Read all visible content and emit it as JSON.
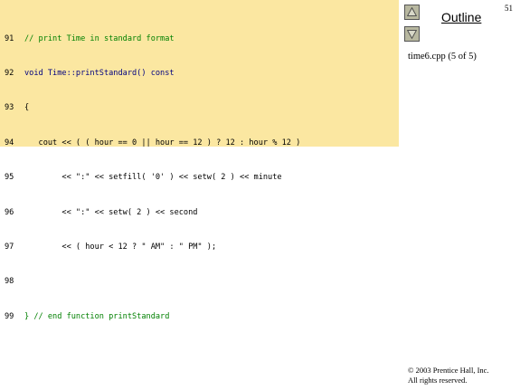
{
  "slide": {
    "page_number": "51",
    "outline_title": "Outline",
    "file_label": "time6.cpp (5 of 5)",
    "copyright_line1": "© 2003 Prentice Hall, Inc.",
    "copyright_line2": "All rights reserved."
  },
  "nav": {
    "up_icon": "triangle-up-icon",
    "down_icon": "triangle-down-icon"
  },
  "code": {
    "lines": [
      {
        "num": "91",
        "text": "// print Time in standard format"
      },
      {
        "num": "92",
        "text": "void Time::printStandard() const"
      },
      {
        "num": "93",
        "text": "{"
      },
      {
        "num": "94",
        "text": "   cout << ( ( hour == 0 || hour == 12 ) ? 12 : hour % 12 )"
      },
      {
        "num": "95",
        "text": "        << \":\" << setfill( '0' ) << setw( 2 ) << minute"
      },
      {
        "num": "96",
        "text": "        << \":\" << setw( 2 ) << second"
      },
      {
        "num": "97",
        "text": "        << ( hour < 12 ? \" AM\" : \" PM\" );"
      },
      {
        "num": "98",
        "text": ""
      },
      {
        "num": "99",
        "text": "} // end function printStandard"
      }
    ]
  },
  "colors": {
    "code_background": "#fbe7a1",
    "comment": "#008000",
    "keyword": "#000080",
    "literal": "#0090c0"
  }
}
